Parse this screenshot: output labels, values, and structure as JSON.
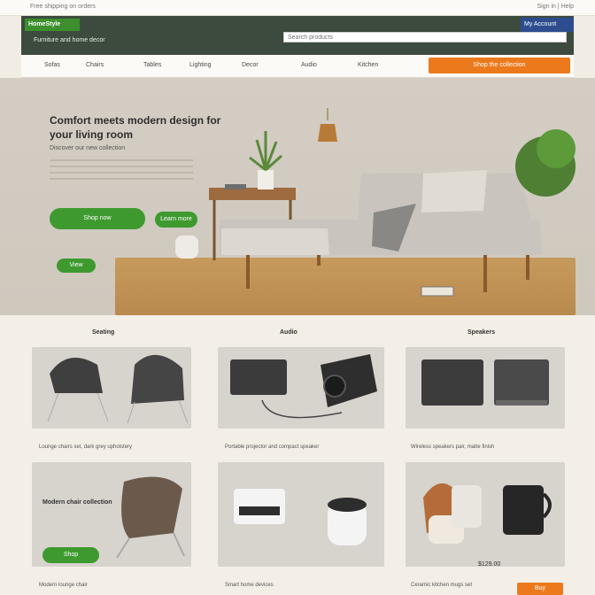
{
  "topbar": {
    "left_text": "Free shipping on orders",
    "right_text": "Sign in  |  Help"
  },
  "header": {
    "logo": "HomeStyle",
    "tagline": "Furniture and home decor",
    "account": "My Account",
    "search_placeholder": "Search products"
  },
  "nav": {
    "items": [
      "Sofas",
      "Chairs",
      "Tables",
      "Lighting",
      "Decor",
      "Audio",
      "Kitchen"
    ],
    "cta": "Shop the collection"
  },
  "hero": {
    "title": "Comfort meets modern design for your living room",
    "subtitle": "Discover our new collection",
    "primary_button": "Shop now",
    "secondary_button": "Learn more",
    "tertiary_button": "View"
  },
  "products": {
    "col_titles": [
      "Seating",
      "Audio",
      "Speakers"
    ],
    "captions": [
      "Lounge chairs set, dark grey upholstery",
      "Portable projector and compact speaker",
      "Wireless speakers pair, matte finish",
      "Modern lounge chair",
      "Smart home devices",
      "Ceramic kitchen mugs set"
    ],
    "promo_text": "Modern chair collection",
    "promo_button": "Shop",
    "price": "$129.00",
    "price_badge": "Buy"
  }
}
